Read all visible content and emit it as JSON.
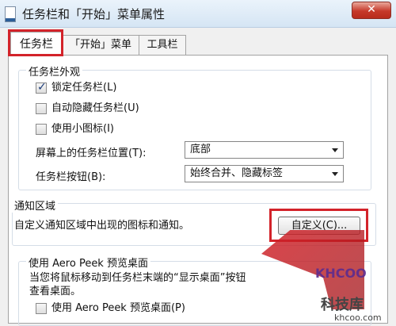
{
  "window": {
    "title": "任务栏和「开始」菜单属性",
    "close_glyph": "✕"
  },
  "tabs": [
    {
      "label": "任务栏",
      "selected": true
    },
    {
      "label": "「开始」菜单",
      "selected": false
    },
    {
      "label": "工具栏",
      "selected": false
    }
  ],
  "appearance": {
    "group_label": "任务栏外观",
    "lock": {
      "label": "锁定任务栏(L)",
      "checked": true
    },
    "autohide": {
      "label": "自动隐藏任务栏(U)",
      "checked": false
    },
    "small_icons": {
      "label": "使用小图标(I)",
      "checked": false
    },
    "position": {
      "label": "屏幕上的任务栏位置(T):",
      "value": "底部"
    },
    "buttons": {
      "label": "任务栏按钮(B):",
      "value": "始终合并、隐藏标签"
    }
  },
  "notification": {
    "group_label": "通知区域",
    "description": "自定义通知区域中出现的图标和通知。",
    "customize_button": "自定义(C)..."
  },
  "aero_peek": {
    "group_label": "使用 Aero Peek 预览桌面",
    "description_line1": "当您将鼠标移动到任务栏末端的“显示桌面”按钮",
    "description_line2": "查看桌面。",
    "checkbox": {
      "label": "使用 Aero Peek 预览桌面(P)",
      "checked": false
    }
  },
  "watermark": {
    "logo": "KHCOO",
    "main": "科技库",
    "sub": "khcoo.com"
  },
  "colors": {
    "highlight": "#d3232a"
  }
}
